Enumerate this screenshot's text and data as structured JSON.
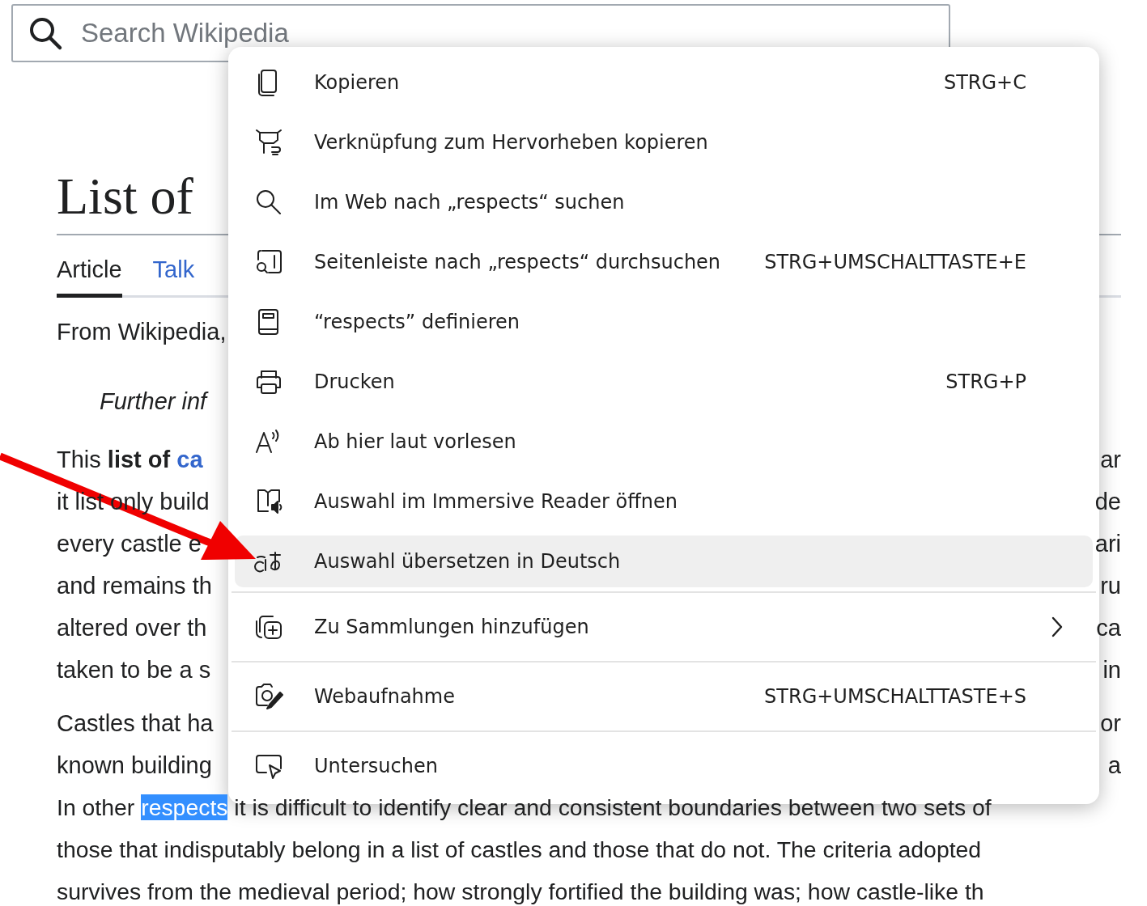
{
  "search": {
    "placeholder": "Search Wikipedia"
  },
  "article": {
    "title": "List of",
    "tabs": [
      {
        "label": "Article",
        "selected": true
      },
      {
        "label": "Talk",
        "selected": false
      }
    ],
    "source": "From Wikipedia,",
    "hatnote": "Further inf",
    "paragraphs": [
      {
        "lines": [
          {
            "kind": "split",
            "left": "This **list of** ",
            "link": "ca",
            "right": "ar"
          },
          {
            "kind": "split",
            "left": "it list only build",
            "right": "de"
          },
          {
            "kind": "split",
            "left": "every castle e",
            "right": "ari"
          },
          {
            "kind": "split",
            "left": "and remains th",
            "right": "ru"
          },
          {
            "kind": "split",
            "left": "altered over th",
            "right": "ca"
          },
          {
            "kind": "split",
            "left": "taken to be a s",
            "right": "in"
          }
        ]
      },
      {
        "lines": [
          {
            "kind": "split",
            "left": "Castles that ha",
            "right": "or"
          },
          {
            "kind": "split",
            "left": "known building",
            "right": "a"
          },
          {
            "kind": "full",
            "left": "In other ",
            "selection": "respects",
            "right": " it is difficult to identify clear and consistent boundaries between two sets of"
          },
          {
            "kind": "full",
            "left": "those that indisputably belong in a list of castles and those that do not. The criteria adopted"
          },
          {
            "kind": "full",
            "left": "survives from the medieval period; how strongly fortified the building was; how castle-like th"
          }
        ]
      }
    ]
  },
  "menu": {
    "groups": [
      [
        {
          "kind": "action",
          "label": "Kopieren",
          "shortcut": "STRG+C",
          "selected": false
        },
        {
          "kind": "action",
          "label": "Verknüpfung zum Hervorheben kopieren",
          "selected": false
        },
        {
          "kind": "action",
          "label": "Im Web nach „respects“ suchen",
          "selected": false
        },
        {
          "kind": "action",
          "label": "Seitenleiste nach „respects“ durchsuchen",
          "shortcut": "STRG+UMSCHALTTASTE+E",
          "selected": false
        },
        {
          "kind": "action",
          "label": "“respects” definieren",
          "selected": false
        },
        {
          "kind": "action",
          "label": "Drucken",
          "shortcut": "STRG+P",
          "selected": false
        },
        {
          "kind": "action",
          "label": "Ab hier laut vorlesen",
          "selected": false
        },
        {
          "kind": "action",
          "label": "Auswahl im Immersive Reader öffnen",
          "selected": false
        },
        {
          "kind": "action",
          "label": "Auswahl übersetzen in Deutsch",
          "selected": true
        }
      ],
      [
        {
          "kind": "submenu",
          "label": "Zu Sammlungen hinzufügen",
          "selected": false
        }
      ],
      [
        {
          "kind": "action",
          "label": "Webaufnahme",
          "shortcut": "STRG+UMSCHALTTASTE+S",
          "selected": false
        }
      ],
      [
        {
          "kind": "action",
          "label": "Untersuchen",
          "selected": false
        }
      ]
    ]
  }
}
